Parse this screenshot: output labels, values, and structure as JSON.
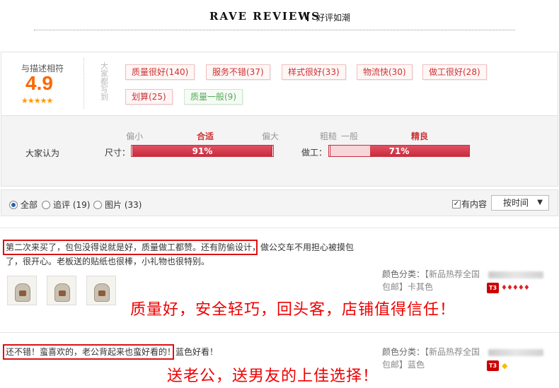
{
  "header": {
    "title": "RAVE REVIEWS",
    "subtitle": "好评如潮"
  },
  "summary": {
    "rating_label": "与描述相符",
    "rating": "4.9",
    "stars": "★★★★★",
    "vertical_label": "大家都写到",
    "tags": [
      {
        "label": "质量很好(140)",
        "sentiment": "positive"
      },
      {
        "label": "服务不错(37)",
        "sentiment": "positive"
      },
      {
        "label": "样式很好(33)",
        "sentiment": "positive"
      },
      {
        "label": "物流快(30)",
        "sentiment": "positive"
      },
      {
        "label": "做工很好(28)",
        "sentiment": "positive"
      },
      {
        "label": "划算(25)",
        "sentiment": "positive"
      },
      {
        "label": "质量一般(9)",
        "sentiment": "neutral"
      }
    ],
    "crowd_label": "大家认为",
    "size": {
      "label": "尺寸：",
      "low": "偏小",
      "mid": "合适",
      "high": "偏大",
      "percent_text": "91%",
      "percent": 91
    },
    "work": {
      "label": "做工：",
      "low": "粗糙",
      "mid_low": "一般",
      "mid": "精良",
      "percent_text": "71%",
      "percent": 71
    }
  },
  "filter": {
    "options": [
      {
        "label": "全部",
        "selected": true
      },
      {
        "label": "追评 (19)",
        "selected": false
      },
      {
        "label": "图片 (33)",
        "selected": false
      }
    ],
    "has_content_label": "有内容",
    "has_content_checked": true,
    "sort_label": "按时间"
  },
  "reviews": [
    {
      "text_highlight": "第二次来买了，包包没得说就是好，质量做工都赞。还有防偷设计，",
      "text_rest_line1": "做公交车不用担心被摸包",
      "text_line2": "了，很开心。老板送的贴纸也很棒，小礼物也很特别。",
      "annotation": "质量好，安全轻巧，回头客，店铺值得信任！",
      "meta_label": "颜色分类：",
      "meta_value": "【新品热荐全国包邮】卡其色",
      "level": "T3"
    },
    {
      "text_highlight": "还不错！蛮喜欢的，老公背起来也蛮好看的！",
      "text_rest_line1": "蓝色好看！",
      "annotation": "送老公，送男友的上佳选择！",
      "meta_label": "颜色分类：",
      "meta_value": "【新品热荐全国包邮】蓝色",
      "level": "T3"
    }
  ]
}
